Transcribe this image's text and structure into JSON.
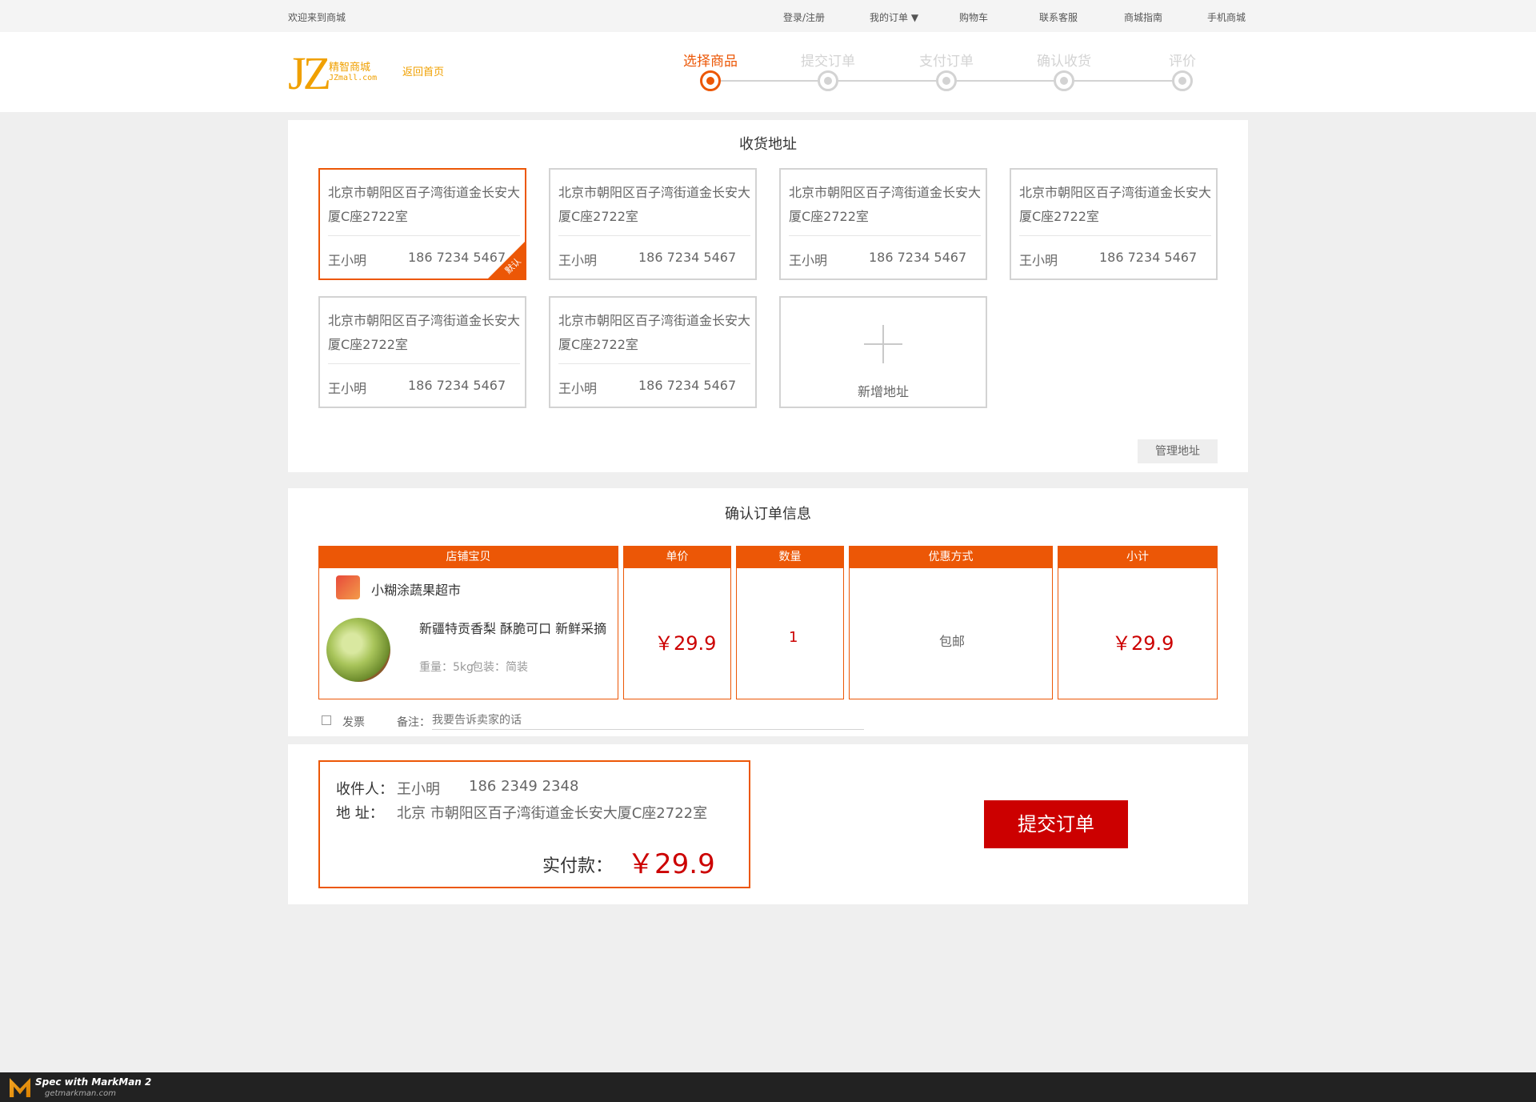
{
  "topbar": {
    "welcome": "欢迎来到商城",
    "links": [
      "登录/注册",
      "我的订单 ▼",
      "购物车",
      "联系客服",
      "商城指南",
      "手机商城"
    ]
  },
  "header": {
    "logo_mark": "JZ",
    "logo_name": "精智商城",
    "logo_url": "JZmall.com",
    "back_home": "返回首页",
    "steps": [
      "选择商品",
      "提交订单",
      "支付订单",
      "确认收货",
      "评价"
    ],
    "active_step": 0,
    "colors": {
      "active": "#ec5706",
      "inactive": "#d3d3d3"
    }
  },
  "address_section": {
    "title": "收货地址",
    "cards": [
      {
        "address": "北京市朝阳区百子湾街道金长安大厦C座2722室",
        "name": "王小明",
        "phone": "186 7234 5467",
        "default": true
      },
      {
        "address": "北京市朝阳区百子湾街道金长安大厦C座2722室",
        "name": "王小明",
        "phone": "186 7234 5467",
        "default": false
      },
      {
        "address": "北京市朝阳区百子湾街道金长安大厦C座2722室",
        "name": "王小明",
        "phone": "186 7234 5467",
        "default": false
      },
      {
        "address": "北京市朝阳区百子湾街道金长安大厦C座2722室",
        "name": "王小明",
        "phone": "186 7234 5467",
        "default": false
      },
      {
        "address": "北京市朝阳区百子湾街道金长安大厦C座2722室",
        "name": "王小明",
        "phone": "186 7234 5467",
        "default": false
      },
      {
        "address": "北京市朝阳区百子湾街道金长安大厦C座2722室",
        "name": "王小明",
        "phone": "186 7234 5467",
        "default": false
      }
    ],
    "default_badge": "默认",
    "add_label": "新增地址",
    "manage_label": "管理地址"
  },
  "order_section": {
    "title": "确认订单信息",
    "headers": [
      "店铺宝贝",
      "单价",
      "数量",
      "优惠方式",
      "小计"
    ],
    "shop_name": "小糊涂蔬果超市",
    "product_name": "新疆特贡香梨 酥脆可口 新鲜采摘",
    "weight": "重量：5kg",
    "packaging": "包装：简装",
    "unit_price": "￥29.9",
    "quantity": "1",
    "shipping": "包邮",
    "subtotal": "￥29.9",
    "invoice_label": "发票",
    "remark_label": "备注：",
    "remark_placeholder": "我要告诉卖家的话"
  },
  "summary": {
    "receiver_label": "收件人：",
    "receiver_name": "王小明",
    "receiver_phone": "186 2349 2348",
    "address_label": "地  址：",
    "address": "北京 市朝阳区百子湾街道金长安大厦C座2722室",
    "pay_label": "实付款：",
    "pay_amount": "￥29.9",
    "submit": "提交订单"
  },
  "footer": {
    "brand": "Spec with MarkMan 2",
    "site": "getmarkman.com"
  }
}
